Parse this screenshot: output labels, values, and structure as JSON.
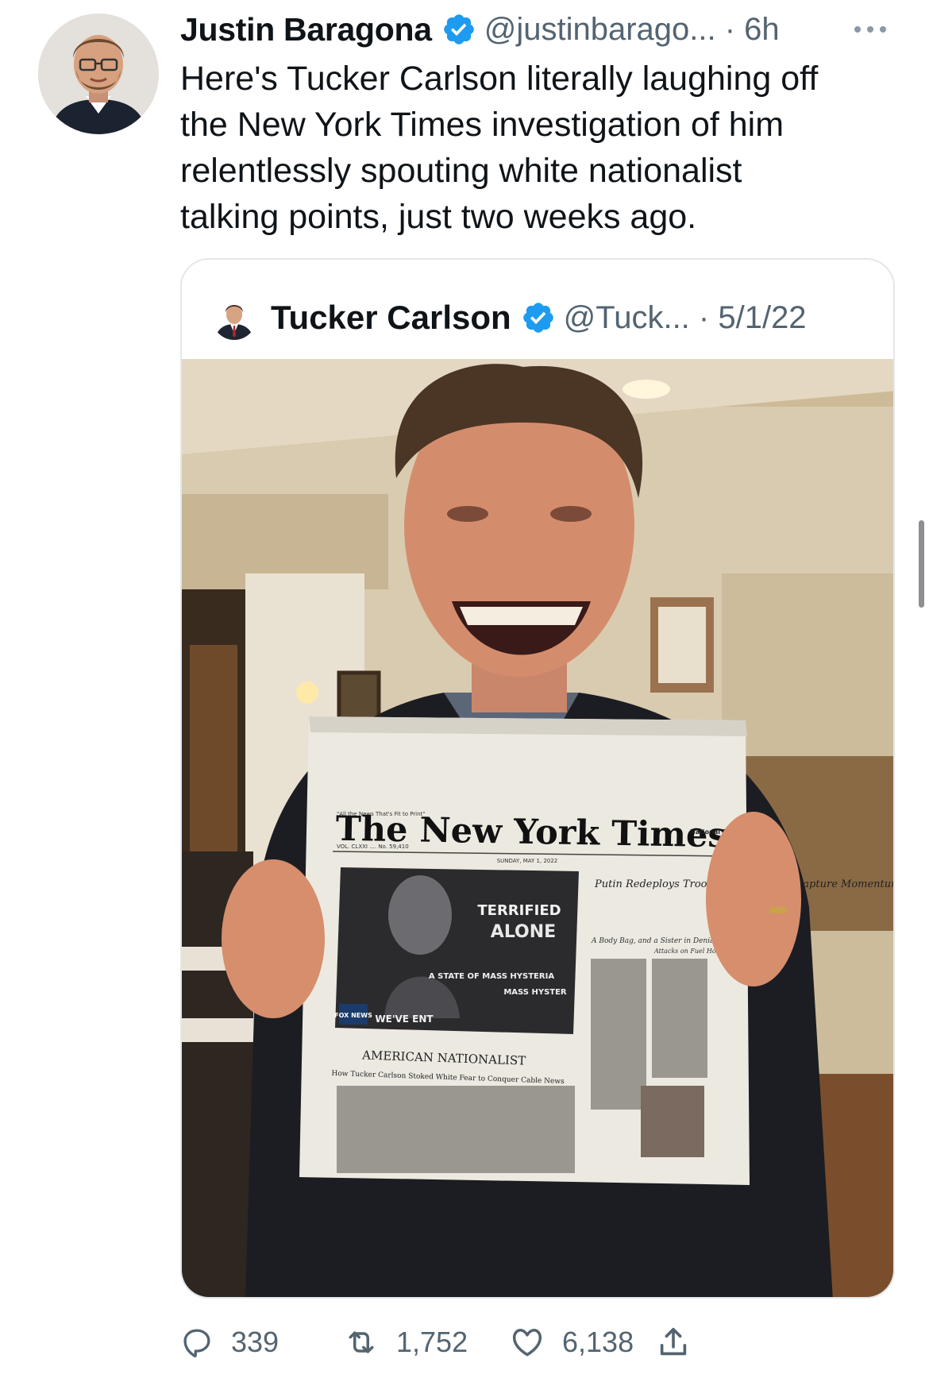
{
  "tweet": {
    "author_name": "Justin Baragona",
    "handle_time": "@justinbarago... · 6h",
    "text": "Here's Tucker Carlson literally laughing off\nthe New York Times investigation of him\nrelentlessly spouting white nationalist\ntalking points, just two weeks ago.",
    "avatar_icon": "avatar-man-glasses-beard",
    "verified_icon": "verified-badge-icon",
    "more_icon": "more-dots-icon"
  },
  "quote": {
    "author_name": "Tucker Carlson",
    "handle_date": "@Tuck... · 5/1/22",
    "photo": {
      "subject": "smiling-man-holding-newspaper",
      "newspaper": {
        "masthead": "The New York Times",
        "ears_left": "\"All the News\nThat's Fit to Print\"",
        "ears_right": "National Edition",
        "dateline": "SUNDAY, MAY 1, 2022",
        "volume": "VOL. CLXXI .... No. 59,410",
        "section_headline": "AMERICAN NATIONALIST",
        "headline": "How Tucker Carlson Stoked White Fear to Conquer Cable News",
        "side_headline": "Putin Redeploys Troops In Effort to Recapture Momentum in Ukraine",
        "side_sub_left": "A Body Bag, and a Sister in Denial",
        "side_sub_right": "Attacks on Fuel Hobble Country",
        "tv_caption_1": "TERRIFIED",
        "tv_caption_2": "ALONE",
        "tv_caption_3": "A STATE OF MASS HYSTERIA",
        "tv_caption_4": "WE'VE ENT",
        "tv_caption_5": "MASS HYSTER",
        "tv_logo": "FOX NEWS"
      }
    }
  },
  "actions": {
    "reply_count": "339",
    "retweet_count": "1,752",
    "like_count": "6,138",
    "icons": [
      "reply-icon",
      "retweet-icon",
      "like-icon",
      "share-icon"
    ]
  },
  "colors": {
    "verified": "#1d9bf0",
    "muted": "#536471",
    "border": "#e3e7ea"
  }
}
